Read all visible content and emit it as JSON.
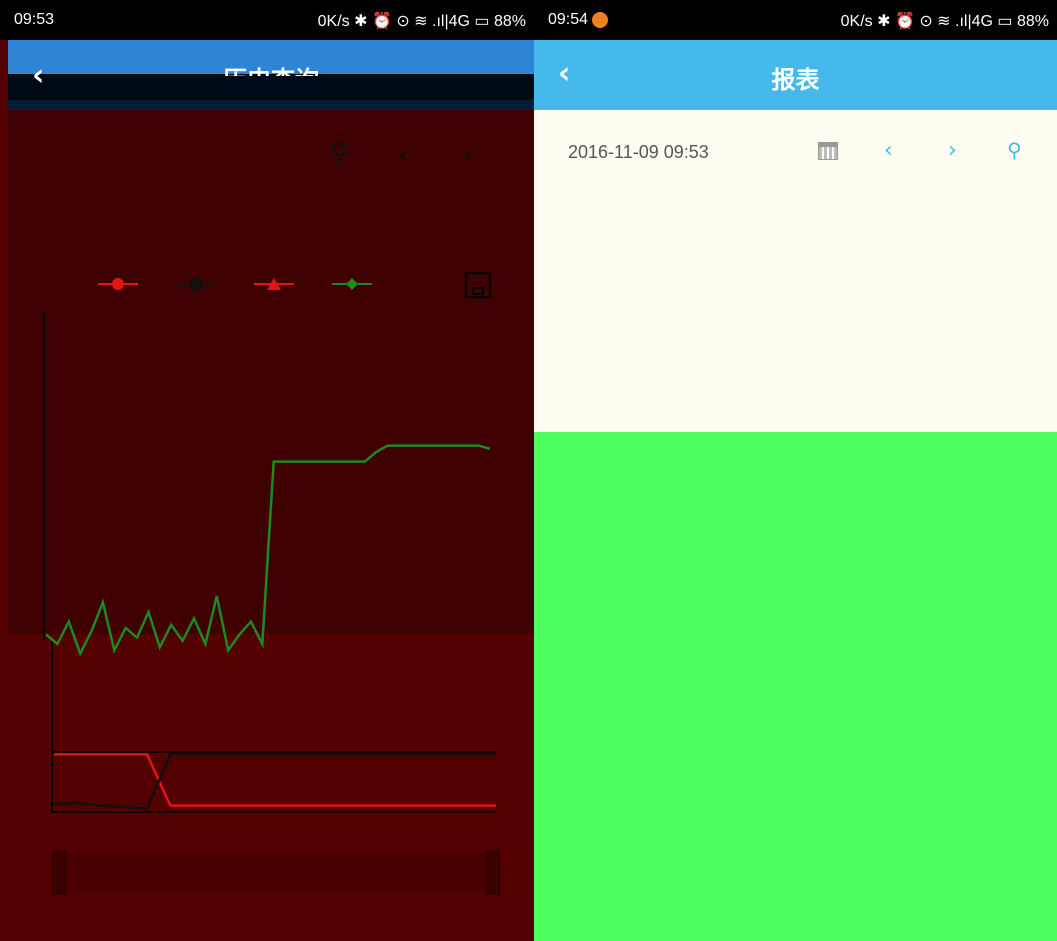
{
  "left_phone": {
    "status_bar": {
      "time": "09:53",
      "indicators": "0K/s ✱ ⏰ ⊙ ≋ .ıl|4G ▭ 88%"
    },
    "header": {
      "title": "历史查询",
      "back_icon": "chevron-left-icon"
    },
    "toolbar": {
      "icons": [
        "search-icon",
        "chevron-left-icon",
        "chevron-right-icon"
      ]
    },
    "legend": [
      {
        "color": "#e01515",
        "marker": "circle"
      },
      {
        "color": "#111111",
        "marker": "square"
      },
      {
        "color": "#e01515",
        "marker": "triangle"
      },
      {
        "color": "#1e8a1e",
        "marker": "diamond"
      }
    ],
    "save_icon": "save-icon"
  },
  "chart_data": [
    {
      "type": "line",
      "title": "",
      "xlabel": "",
      "ylabel": "",
      "series": [
        {
          "color": "#1e8a1e",
          "values": [
            0.08,
            0.05,
            0.12,
            0.02,
            0.09,
            0.18,
            0.03,
            0.1,
            0.07,
            0.15,
            0.04,
            0.11,
            0.06,
            0.13,
            0.05,
            0.2,
            0.03,
            0.08,
            0.12,
            0.05,
            0.62,
            0.62,
            0.62,
            0.62,
            0.62,
            0.62,
            0.62,
            0.62,
            0.62,
            0.65,
            0.67,
            0.67,
            0.67,
            0.67,
            0.67,
            0.67,
            0.67,
            0.67,
            0.67,
            0.66
          ]
        }
      ],
      "ylim": [
        0,
        1
      ]
    },
    {
      "type": "line",
      "title": "",
      "series": [
        {
          "color": "#e01515",
          "values": [
            0.9,
            0.9,
            0.9,
            0.9,
            0.9,
            0.1,
            0.1,
            0.1,
            0.1,
            0.1,
            0.1,
            0.1,
            0.1,
            0.1,
            0.1,
            0.1,
            0.1,
            0.1,
            0.1,
            0.1
          ]
        },
        {
          "color": "#111111",
          "values": [
            0.12,
            0.14,
            0.1,
            0.08,
            0.05,
            0.9,
            0.9,
            0.9,
            0.9,
            0.9,
            0.9,
            0.9,
            0.9,
            0.9,
            0.9,
            0.9,
            0.9,
            0.9,
            0.9,
            0.9
          ]
        }
      ],
      "ylim": [
        0,
        1
      ]
    }
  ],
  "right_phone": {
    "status_bar": {
      "time": "09:54",
      "indicators": "0K/s ✱ ⏰ ⊙ ≋ .ıl|4G ▭ 88%"
    },
    "header": {
      "title": "报表",
      "back_icon": "chevron-left-icon"
    },
    "date_value": "2016-11-09 09:53",
    "calendar_icon": "calendar-icon",
    "prev_label": "‹",
    "next_label": "›",
    "search_icon": "search-icon"
  }
}
